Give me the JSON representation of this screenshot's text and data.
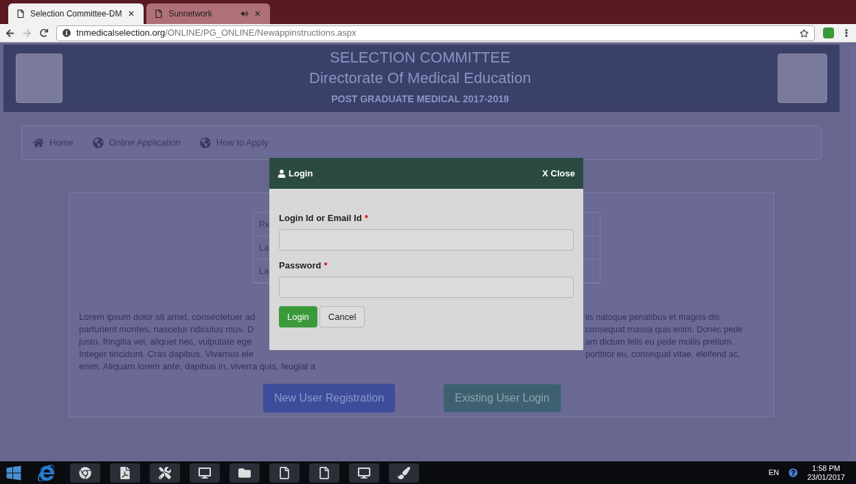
{
  "browser": {
    "tabs": [
      {
        "label": "Selection Committee-DM",
        "selected": true,
        "audio": false,
        "close": "✕"
      },
      {
        "label": "Sunnetwork",
        "selected": false,
        "audio": true,
        "close": "✕"
      }
    ],
    "url_host": "tnmedicalselection.org",
    "url_path": "/ONLINE/PG_ONLINE/Newappinstructions.aspx"
  },
  "header": {
    "title": "SELECTION COMMITTEE",
    "subtitle": "Directorate Of Medical Education",
    "course": "POST GRADUATE MEDICAL 2017-2018"
  },
  "nav": [
    {
      "label": "Home",
      "kind": "home"
    },
    {
      "label": "Online Application",
      "kind": "globe"
    },
    {
      "label": "How to Apply",
      "kind": "globe"
    }
  ],
  "table_rows": [
    "Re",
    "La",
    "La"
  ],
  "paragraph_left": [
    "Lorem ipsum dolor sit amet, consectetuer ad",
    "parturient montes, nascetur ridiculus mus. D",
    "justo, fringilla vel, aliquet nec, vulputate ege",
    "Integer tincidunt. Cras dapibus. Vivamus ele"
  ],
  "paragraph_right": [
    "iis natoque penatibus et magnis dis",
    "consequat massa quis enim. Donec pede",
    "am dictum felis eu pede mollis pretium.",
    "porttitor eu, consequat vitae, eleifend ac,"
  ],
  "paragraph_last": "enim. Aliquam lorem ante, dapibus in, viverra quis, feugiat a",
  "actions": [
    "New User Registration",
    "Existing User Login"
  ],
  "modal": {
    "title": "Login",
    "close": "X Close",
    "fields": [
      {
        "label": "Login Id or Email Id",
        "required_mark": "*"
      },
      {
        "label": "Password",
        "required_mark": "*"
      }
    ],
    "submit": "Login",
    "cancel": "Cancel"
  },
  "taskbar": {
    "language": "EN",
    "time": "1:58 PM",
    "date": "23/01/2017"
  }
}
